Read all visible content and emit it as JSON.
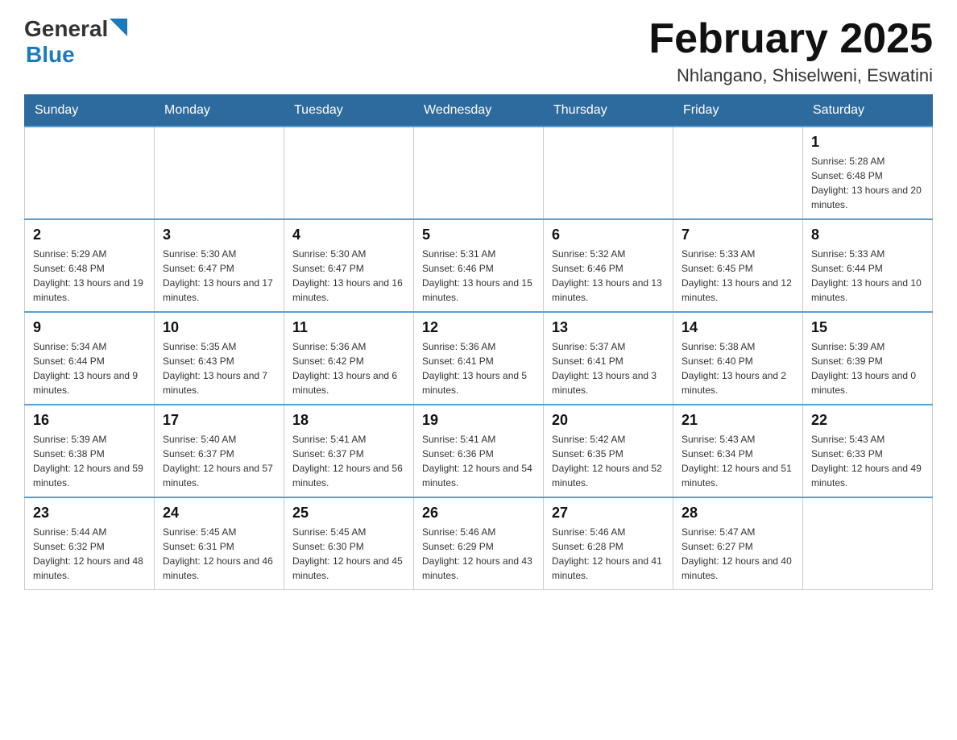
{
  "header": {
    "logo_general": "General",
    "logo_blue": "Blue",
    "title": "February 2025",
    "subtitle": "Nhlangano, Shiselweni, Eswatini"
  },
  "days_of_week": [
    "Sunday",
    "Monday",
    "Tuesday",
    "Wednesday",
    "Thursday",
    "Friday",
    "Saturday"
  ],
  "weeks": [
    [
      {
        "day": "",
        "sunrise": "",
        "sunset": "",
        "daylight": ""
      },
      {
        "day": "",
        "sunrise": "",
        "sunset": "",
        "daylight": ""
      },
      {
        "day": "",
        "sunrise": "",
        "sunset": "",
        "daylight": ""
      },
      {
        "day": "",
        "sunrise": "",
        "sunset": "",
        "daylight": ""
      },
      {
        "day": "",
        "sunrise": "",
        "sunset": "",
        "daylight": ""
      },
      {
        "day": "",
        "sunrise": "",
        "sunset": "",
        "daylight": ""
      },
      {
        "day": "1",
        "sunrise": "Sunrise: 5:28 AM",
        "sunset": "Sunset: 6:48 PM",
        "daylight": "Daylight: 13 hours and 20 minutes."
      }
    ],
    [
      {
        "day": "2",
        "sunrise": "Sunrise: 5:29 AM",
        "sunset": "Sunset: 6:48 PM",
        "daylight": "Daylight: 13 hours and 19 minutes."
      },
      {
        "day": "3",
        "sunrise": "Sunrise: 5:30 AM",
        "sunset": "Sunset: 6:47 PM",
        "daylight": "Daylight: 13 hours and 17 minutes."
      },
      {
        "day": "4",
        "sunrise": "Sunrise: 5:30 AM",
        "sunset": "Sunset: 6:47 PM",
        "daylight": "Daylight: 13 hours and 16 minutes."
      },
      {
        "day": "5",
        "sunrise": "Sunrise: 5:31 AM",
        "sunset": "Sunset: 6:46 PM",
        "daylight": "Daylight: 13 hours and 15 minutes."
      },
      {
        "day": "6",
        "sunrise": "Sunrise: 5:32 AM",
        "sunset": "Sunset: 6:46 PM",
        "daylight": "Daylight: 13 hours and 13 minutes."
      },
      {
        "day": "7",
        "sunrise": "Sunrise: 5:33 AM",
        "sunset": "Sunset: 6:45 PM",
        "daylight": "Daylight: 13 hours and 12 minutes."
      },
      {
        "day": "8",
        "sunrise": "Sunrise: 5:33 AM",
        "sunset": "Sunset: 6:44 PM",
        "daylight": "Daylight: 13 hours and 10 minutes."
      }
    ],
    [
      {
        "day": "9",
        "sunrise": "Sunrise: 5:34 AM",
        "sunset": "Sunset: 6:44 PM",
        "daylight": "Daylight: 13 hours and 9 minutes."
      },
      {
        "day": "10",
        "sunrise": "Sunrise: 5:35 AM",
        "sunset": "Sunset: 6:43 PM",
        "daylight": "Daylight: 13 hours and 7 minutes."
      },
      {
        "day": "11",
        "sunrise": "Sunrise: 5:36 AM",
        "sunset": "Sunset: 6:42 PM",
        "daylight": "Daylight: 13 hours and 6 minutes."
      },
      {
        "day": "12",
        "sunrise": "Sunrise: 5:36 AM",
        "sunset": "Sunset: 6:41 PM",
        "daylight": "Daylight: 13 hours and 5 minutes."
      },
      {
        "day": "13",
        "sunrise": "Sunrise: 5:37 AM",
        "sunset": "Sunset: 6:41 PM",
        "daylight": "Daylight: 13 hours and 3 minutes."
      },
      {
        "day": "14",
        "sunrise": "Sunrise: 5:38 AM",
        "sunset": "Sunset: 6:40 PM",
        "daylight": "Daylight: 13 hours and 2 minutes."
      },
      {
        "day": "15",
        "sunrise": "Sunrise: 5:39 AM",
        "sunset": "Sunset: 6:39 PM",
        "daylight": "Daylight: 13 hours and 0 minutes."
      }
    ],
    [
      {
        "day": "16",
        "sunrise": "Sunrise: 5:39 AM",
        "sunset": "Sunset: 6:38 PM",
        "daylight": "Daylight: 12 hours and 59 minutes."
      },
      {
        "day": "17",
        "sunrise": "Sunrise: 5:40 AM",
        "sunset": "Sunset: 6:37 PM",
        "daylight": "Daylight: 12 hours and 57 minutes."
      },
      {
        "day": "18",
        "sunrise": "Sunrise: 5:41 AM",
        "sunset": "Sunset: 6:37 PM",
        "daylight": "Daylight: 12 hours and 56 minutes."
      },
      {
        "day": "19",
        "sunrise": "Sunrise: 5:41 AM",
        "sunset": "Sunset: 6:36 PM",
        "daylight": "Daylight: 12 hours and 54 minutes."
      },
      {
        "day": "20",
        "sunrise": "Sunrise: 5:42 AM",
        "sunset": "Sunset: 6:35 PM",
        "daylight": "Daylight: 12 hours and 52 minutes."
      },
      {
        "day": "21",
        "sunrise": "Sunrise: 5:43 AM",
        "sunset": "Sunset: 6:34 PM",
        "daylight": "Daylight: 12 hours and 51 minutes."
      },
      {
        "day": "22",
        "sunrise": "Sunrise: 5:43 AM",
        "sunset": "Sunset: 6:33 PM",
        "daylight": "Daylight: 12 hours and 49 minutes."
      }
    ],
    [
      {
        "day": "23",
        "sunrise": "Sunrise: 5:44 AM",
        "sunset": "Sunset: 6:32 PM",
        "daylight": "Daylight: 12 hours and 48 minutes."
      },
      {
        "day": "24",
        "sunrise": "Sunrise: 5:45 AM",
        "sunset": "Sunset: 6:31 PM",
        "daylight": "Daylight: 12 hours and 46 minutes."
      },
      {
        "day": "25",
        "sunrise": "Sunrise: 5:45 AM",
        "sunset": "Sunset: 6:30 PM",
        "daylight": "Daylight: 12 hours and 45 minutes."
      },
      {
        "day": "26",
        "sunrise": "Sunrise: 5:46 AM",
        "sunset": "Sunset: 6:29 PM",
        "daylight": "Daylight: 12 hours and 43 minutes."
      },
      {
        "day": "27",
        "sunrise": "Sunrise: 5:46 AM",
        "sunset": "Sunset: 6:28 PM",
        "daylight": "Daylight: 12 hours and 41 minutes."
      },
      {
        "day": "28",
        "sunrise": "Sunrise: 5:47 AM",
        "sunset": "Sunset: 6:27 PM",
        "daylight": "Daylight: 12 hours and 40 minutes."
      },
      {
        "day": "",
        "sunrise": "",
        "sunset": "",
        "daylight": ""
      }
    ]
  ]
}
